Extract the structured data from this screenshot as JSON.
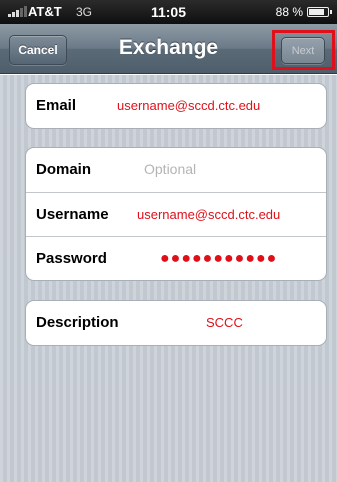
{
  "status_bar": {
    "carrier": "AT&T",
    "network": "3G",
    "time": "11:05",
    "battery": "88 %",
    "battery_level": 0.88
  },
  "nav_bar": {
    "cancel_label": "Cancel",
    "title": "Exchange",
    "next_label": "Next"
  },
  "form": {
    "email": {
      "label": "Email",
      "value": "username@sccd.ctc.edu"
    },
    "domain": {
      "label": "Domain",
      "placeholder": "Optional"
    },
    "username": {
      "label": "Username",
      "value": "username@sccd.ctc.edu"
    },
    "password": {
      "label": "Password",
      "value": "●●●●●●●●●●●"
    },
    "description": {
      "label": "Description",
      "value": "SCCC"
    }
  },
  "colors": {
    "annotation": "#e0101a",
    "nav_bar": "#6a7986",
    "background": "#c8ced6"
  }
}
